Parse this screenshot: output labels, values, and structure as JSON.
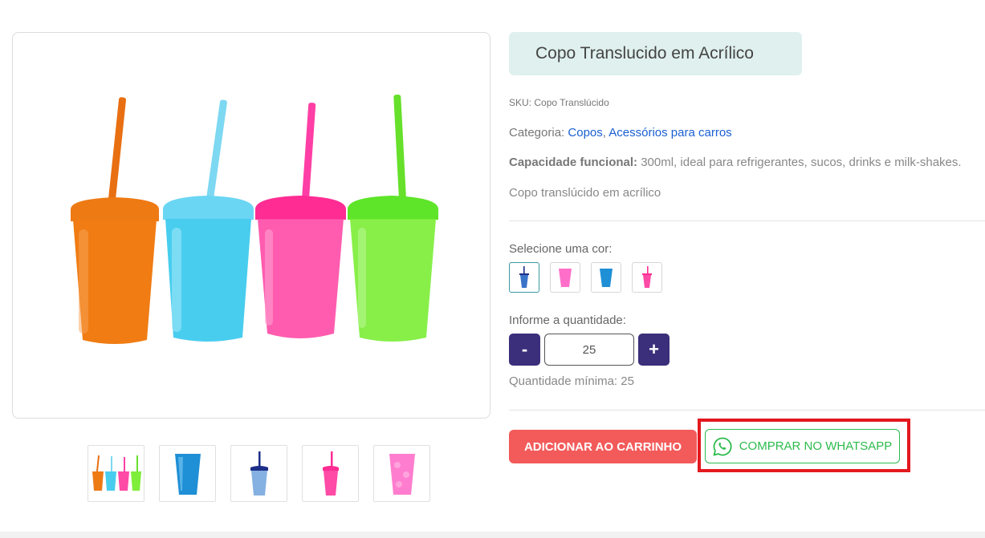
{
  "product": {
    "title": "Copo Translucido em Acrílico",
    "sku_label": "SKU:",
    "sku_value": "Copo Translúcido",
    "category_label": "Categoria:",
    "categories": [
      "Copos",
      "Acessórios para carros"
    ],
    "category_separator": ",",
    "capacity_label": "Capacidade funcional:",
    "capacity_value": "300ml, ideal para refrigerantes, sucos, drinks e milk-shakes.",
    "description": "Copo translúcido em acrílico"
  },
  "gallery": {
    "main_image": "four-colored-cups-orange-blue-pink-green",
    "thumbnails": [
      "four-cups",
      "blue-cup",
      "navy-cup-straw",
      "pink-cup-straw",
      "pink-cup"
    ]
  },
  "color_picker": {
    "label": "Selecione uma cor:",
    "options": [
      "navy",
      "pink",
      "blue",
      "pink-straw"
    ],
    "selected_index": 0
  },
  "quantity": {
    "label": "Informe a quantidade:",
    "minus_label": "-",
    "plus_label": "+",
    "value": "25",
    "min_text": "Quantidade mínima: 25"
  },
  "actions": {
    "add_to_cart": "ADICIONAR AO CARRINHO",
    "whatsapp": "COMPRAR NO WHATSAPP"
  },
  "colors": {
    "accent_purple": "#3b2e7a",
    "cart_red": "#f35a5a",
    "whatsapp_green": "#2dbb4d",
    "highlight_red": "#e3191f",
    "title_bg": "#dff0ee",
    "link_blue": "#1a5fd1"
  }
}
